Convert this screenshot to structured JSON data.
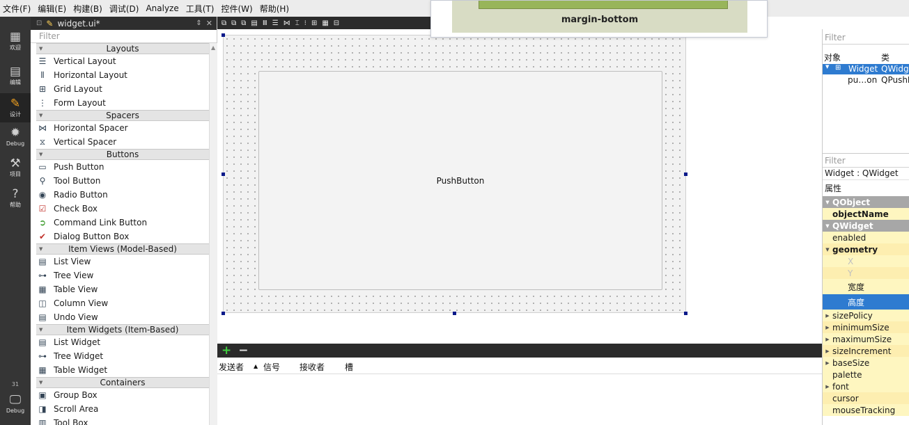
{
  "menu": [
    "文件(F)",
    "编辑(E)",
    "构建(B)",
    "调试(D)",
    "Analyze",
    "工具(T)",
    "控件(W)",
    "帮助(H)"
  ],
  "modes": [
    {
      "label": "欢迎",
      "icon": "grid-icon"
    },
    {
      "label": "编辑",
      "icon": "document-icon"
    },
    {
      "label": "设计",
      "icon": "pencil-icon"
    },
    {
      "label": "Debug",
      "icon": "bug-icon"
    },
    {
      "label": "项目",
      "icon": "wrench-icon"
    },
    {
      "label": "帮助",
      "icon": "help-icon"
    }
  ],
  "kit": {
    "number": "31",
    "label": "Debug"
  },
  "editor": {
    "file_name": "widget.ui*",
    "toolbar_icons": [
      "edit-widgets-icon",
      "edit-signals-icon",
      "edit-buddies-icon",
      "edit-taborder-icon",
      "layout-horizontal-icon",
      "layout-vertical-icon",
      "splitter-h-icon",
      "splitter-v-icon",
      "layout-form-icon",
      "layout-grid-icon",
      "break-layout-icon",
      "adjust-size-icon"
    ]
  },
  "widgetbox": {
    "filter_placeholder": "Filter",
    "sections": [
      {
        "title": "Layouts",
        "items": [
          {
            "label": "Vertical Layout",
            "icon": "vertical-layout-icon"
          },
          {
            "label": "Horizontal Layout",
            "icon": "horizontal-layout-icon"
          },
          {
            "label": "Grid Layout",
            "icon": "grid-layout-icon"
          },
          {
            "label": "Form Layout",
            "icon": "form-layout-icon"
          }
        ]
      },
      {
        "title": "Spacers",
        "items": [
          {
            "label": "Horizontal Spacer",
            "icon": "horizontal-spacer-icon"
          },
          {
            "label": "Vertical Spacer",
            "icon": "vertical-spacer-icon"
          }
        ]
      },
      {
        "title": "Buttons",
        "items": [
          {
            "label": "Push Button",
            "icon": "push-button-icon"
          },
          {
            "label": "Tool Button",
            "icon": "tool-button-icon"
          },
          {
            "label": "Radio Button",
            "icon": "radio-button-icon"
          },
          {
            "label": "Check Box",
            "icon": "check-box-icon"
          },
          {
            "label": "Command Link Button",
            "icon": "command-link-icon"
          },
          {
            "label": "Dialog Button Box",
            "icon": "dialog-button-box-icon"
          }
        ]
      },
      {
        "title": "Item Views (Model-Based)",
        "items": [
          {
            "label": "List View",
            "icon": "list-view-icon"
          },
          {
            "label": "Tree View",
            "icon": "tree-view-icon"
          },
          {
            "label": "Table View",
            "icon": "table-view-icon"
          },
          {
            "label": "Column View",
            "icon": "column-view-icon"
          },
          {
            "label": "Undo View",
            "icon": "undo-view-icon"
          }
        ]
      },
      {
        "title": "Item Widgets (Item-Based)",
        "items": [
          {
            "label": "List Widget",
            "icon": "list-widget-icon"
          },
          {
            "label": "Tree Widget",
            "icon": "tree-widget-icon"
          },
          {
            "label": "Table Widget",
            "icon": "table-widget-icon"
          }
        ]
      },
      {
        "title": "Containers",
        "items": [
          {
            "label": "Group Box",
            "icon": "group-box-icon"
          },
          {
            "label": "Scroll Area",
            "icon": "scroll-area-icon"
          },
          {
            "label": "Tool Box",
            "icon": "tool-box-icon"
          }
        ]
      }
    ]
  },
  "form": {
    "push_button_label": "PushButton"
  },
  "tooltip": {
    "caption": "margin-bottom"
  },
  "signal_slot": {
    "columns": [
      "发送者",
      "信号",
      "接收者",
      "槽"
    ]
  },
  "object_inspector": {
    "filter_placeholder": "Filter",
    "columns": [
      "对象",
      "类"
    ],
    "rows": [
      {
        "object": "Widget",
        "class": "QWidget"
      },
      {
        "object": "pu…on",
        "class": "QPushB"
      }
    ]
  },
  "property_editor": {
    "filter_placeholder": "Filter",
    "class_label": "Widget : QWidget",
    "attr_header": "属性",
    "rows": [
      {
        "label": "QObject",
        "kind": "group"
      },
      {
        "label": "objectName",
        "kind": "bold"
      },
      {
        "label": "QWidget",
        "kind": "group"
      },
      {
        "label": "enabled",
        "kind": "plain"
      },
      {
        "label": "geometry",
        "kind": "bold-expanded"
      },
      {
        "label": "X",
        "kind": "dim"
      },
      {
        "label": "Y",
        "kind": "dim"
      },
      {
        "label": "宽度",
        "kind": "sub"
      },
      {
        "label": "高度",
        "kind": "selected"
      },
      {
        "label": "sizePolicy",
        "kind": "collapsed"
      },
      {
        "label": "minimumSize",
        "kind": "collapsed"
      },
      {
        "label": "maximumSize",
        "kind": "collapsed"
      },
      {
        "label": "sizeIncrement",
        "kind": "collapsed"
      },
      {
        "label": "baseSize",
        "kind": "collapsed"
      },
      {
        "label": "palette",
        "kind": "plain"
      },
      {
        "label": "font",
        "kind": "collapsed"
      },
      {
        "label": "cursor",
        "kind": "plain"
      },
      {
        "label": "mouseTracking",
        "kind": "plain"
      }
    ]
  },
  "colors": {
    "selection": "#2e7bd0",
    "group_header": "#a7a7a7",
    "property_yellow": "#fef6c0",
    "mode_bar": "#353535"
  }
}
